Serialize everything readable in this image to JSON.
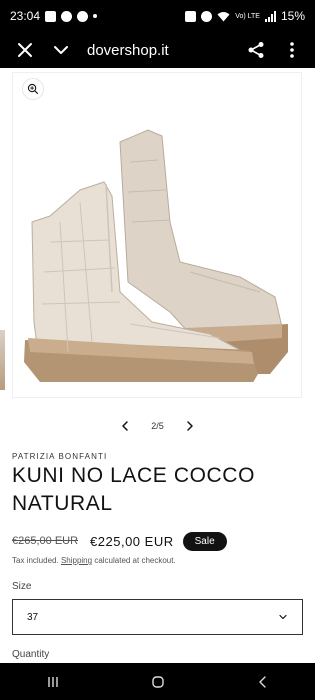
{
  "status_bar": {
    "time": "23:04",
    "network_label": "Vo) LTE",
    "battery": "15%"
  },
  "browser": {
    "url": "dovershop.it"
  },
  "gallery": {
    "pager": "2/5"
  },
  "product": {
    "vendor": "PATRIZIA BONFANTI",
    "title": "KUNI NO LACE COCCO NATURAL",
    "regular_price": "€265,00 EUR",
    "sale_price": "€225,00 EUR",
    "sale_badge": "Sale",
    "tax_prefix": "Tax included.",
    "tax_link": "Shipping",
    "tax_suffix": "calculated at checkout."
  },
  "size": {
    "label": "Size",
    "selected": "37"
  },
  "quantity": {
    "label": "Quantity"
  },
  "colors": {
    "sale_badge_bg": "#121212",
    "boot_leather": "#e3dbd0",
    "boot_sole": "#b39473"
  }
}
